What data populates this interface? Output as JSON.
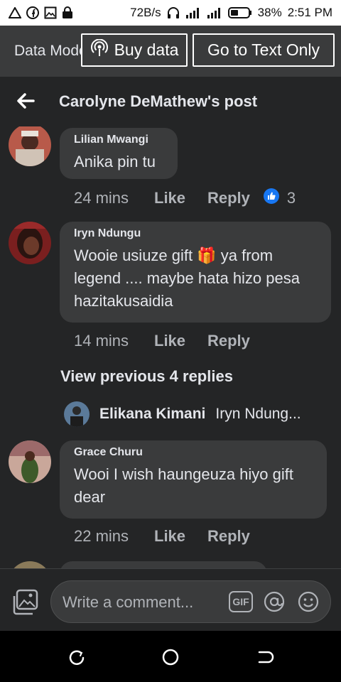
{
  "status_bar": {
    "left_icons": [
      "warning-icon",
      "facebook-icon",
      "image-icon",
      "lock-icon"
    ],
    "network_speed": "72B/s",
    "battery": "38%",
    "time": "2:51 PM"
  },
  "data_bar": {
    "mode_label": "Data Mode",
    "buy_data_label": "Buy data",
    "text_only_label": "Go to Text Only"
  },
  "header": {
    "title": "Carolyne DeMathew's post"
  },
  "comments": [
    {
      "author": "Lilian Mwangi",
      "text": "Anika pin tu",
      "time": "24 mins",
      "like": "Like",
      "reply": "Reply",
      "reaction_count": "3"
    },
    {
      "author": "Iryn Ndungu",
      "text": "Wooie usiuze gift 🎁 ya from legend .... maybe hata hizo pesa hazitakusaidia",
      "time": "14 mins",
      "like": "Like",
      "reply": "Reply"
    },
    {
      "author": "Grace Churu",
      "text": "Wooi I wish haungeuza hiyo gift dear",
      "time": "22 mins",
      "like": "Like",
      "reply": "Reply"
    }
  ],
  "view_previous": "View previous 4 replies",
  "reply_preview": {
    "author": "Elikana Kimani",
    "text": "Iryn Ndung..."
  },
  "composer": {
    "placeholder": "Write a comment...",
    "gif_label": "GIF"
  },
  "colors": {
    "background": "#242526",
    "bubble": "#3a3b3c",
    "text": "#e4e6eb",
    "secondary": "#b0b3b8",
    "like_blue": "#1877f2"
  }
}
